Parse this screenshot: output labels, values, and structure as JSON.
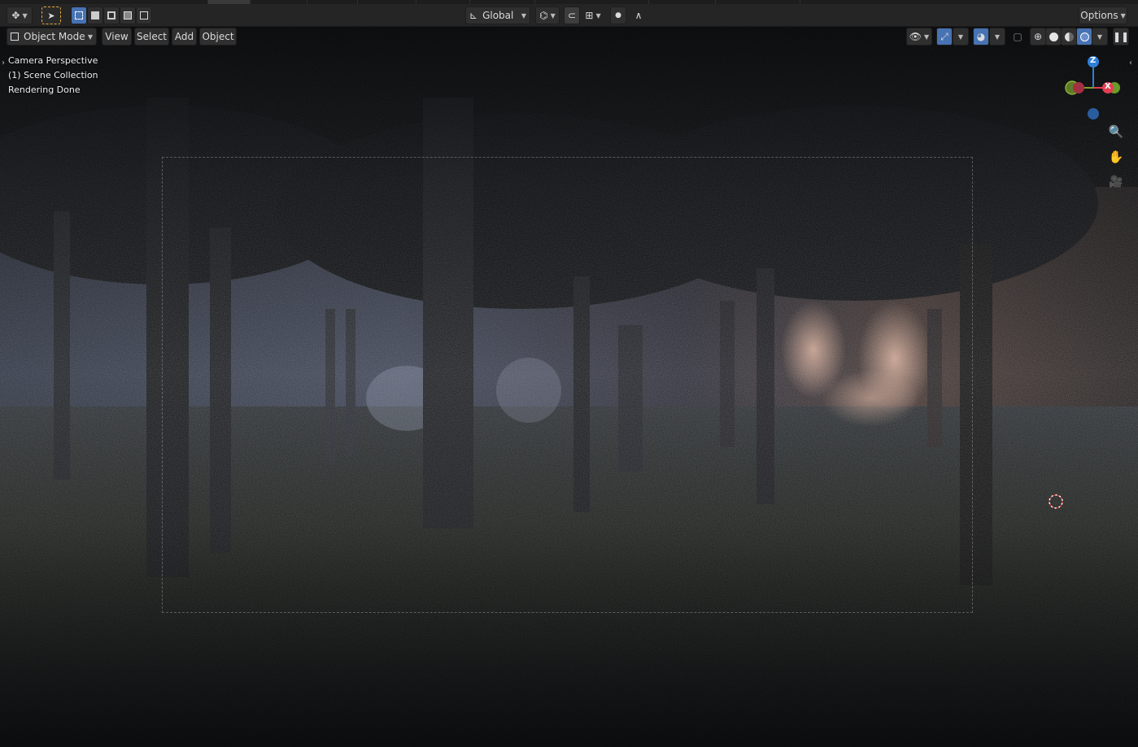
{
  "header": {
    "orientation_label": "Global",
    "options_label": "Options"
  },
  "viewport_header": {
    "mode_label": "Object Mode",
    "menus": [
      "View",
      "Select",
      "Add",
      "Object"
    ]
  },
  "overlay": {
    "line1": "Camera Perspective",
    "line2": "(1) Scene Collection",
    "line3": "Rendering Done"
  },
  "gizmo": {
    "z_label": "Z",
    "x_label": "X"
  },
  "colors": {
    "active_blue": "#4772b3",
    "axis_x": "#e33e54",
    "axis_y": "#7aa22c",
    "axis_z": "#2f7fd9"
  },
  "icons": [
    "cursor-tool-icon",
    "select-box-icon",
    "transform-pivot-icon",
    "snap-icon",
    "proportional-edit-icon",
    "visibility-icon",
    "gizmo-toggle-icon",
    "overlays-icon",
    "xray-icon",
    "wireframe-shading-icon",
    "solid-shading-icon",
    "material-shading-icon",
    "rendered-shading-icon",
    "zoom-icon",
    "pan-hand-icon",
    "camera-view-icon",
    "pause-icon"
  ]
}
